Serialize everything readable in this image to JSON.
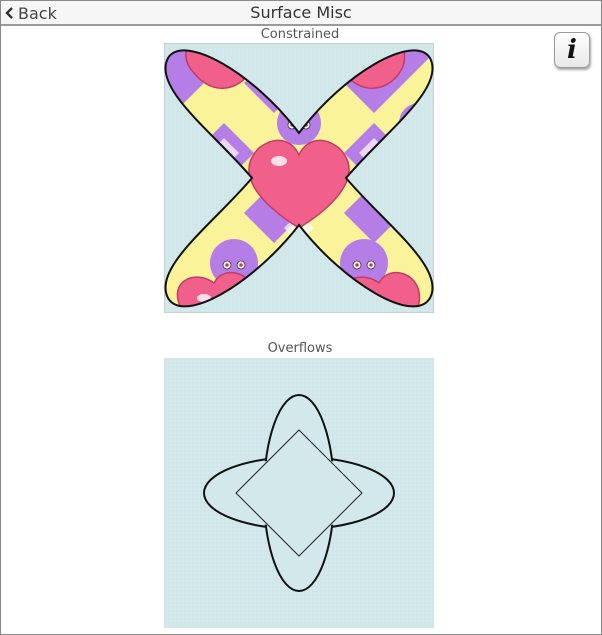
{
  "topbar": {
    "back_label": "Back",
    "title": "Surface Misc"
  },
  "sections": {
    "constrained_label": "Constrained",
    "overflows_label": "Overflows"
  },
  "info_button": {
    "label": "i"
  },
  "colors": {
    "surface_bg": "#d3e8ea",
    "heart_pink": "#f0608a",
    "diamond_yellow": "#fbf39a",
    "band_purple": "#b57ee6",
    "outline": "#111111"
  },
  "icons": {
    "back": "chevron-left-icon",
    "info": "info-icon"
  }
}
